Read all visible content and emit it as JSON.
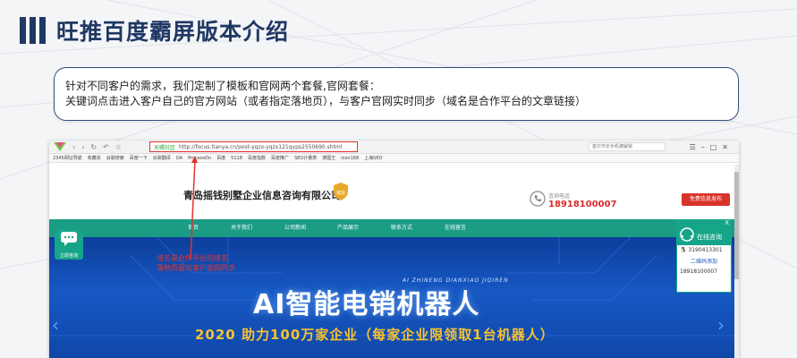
{
  "slide": {
    "title": "旺推百度霸屏版本介绍",
    "note_line1": "针对不同客户的需求，我们定制了模板和官网两个套餐,官网套餐：",
    "note_line2": "关键词点击进入客户自己的官方网站（或者指定落地页），与客户官网实时同步（域名是合作平台的文章链接）"
  },
  "browser": {
    "url_prefix": "天赐社区",
    "url": "http://focus.tianya.cn/post-yqzx-yqzx121qyps2550690.shtml",
    "search_placeholder": "首尔市长手机被解锁",
    "bookmarks": [
      "2345网址导航",
      "收藏夹",
      "谷歌搜索",
      "百度一下",
      "谷歌翻译",
      "OA",
      "ProcessOn",
      "百度",
      "5118",
      "百度指数",
      "百度推广",
      "SEO计量表",
      "搜图王",
      "icon168",
      "上海SEO"
    ]
  },
  "site": {
    "company_name": "青岛摇钱别墅企业信息咨询有限公司",
    "shield_text": "诚信",
    "phone_label": "咨询电话",
    "phone_number": "18918100007",
    "free_button": "免费信息发布",
    "nav": [
      "首页",
      "关于我们",
      "公司新闻",
      "产品展示",
      "联系方式",
      "在线留言"
    ]
  },
  "hero": {
    "subtitle": "AI ZHINENG DIANXIAO JIQIREN",
    "title": "AI智能电销机器人",
    "slogan": "2020 助力100万家企业（每家企业限领取1台机器人）"
  },
  "annotation": {
    "line1": "域名是合作平台的域名",
    "line2": "落地页面与客户官网同步"
  },
  "chat": {
    "left_label": "立即咨询",
    "right_title": "在线咨询",
    "qq": "3190413301",
    "qr_link": "二维码添加",
    "phone": "18918100007",
    "close": "X"
  },
  "colors": {
    "title_navy": "#1f3864",
    "teal_nav": "#1b9c85",
    "hero_blue": "#1658c4",
    "slogan_gold": "#f7c232",
    "annot_red": "#e3342f"
  }
}
